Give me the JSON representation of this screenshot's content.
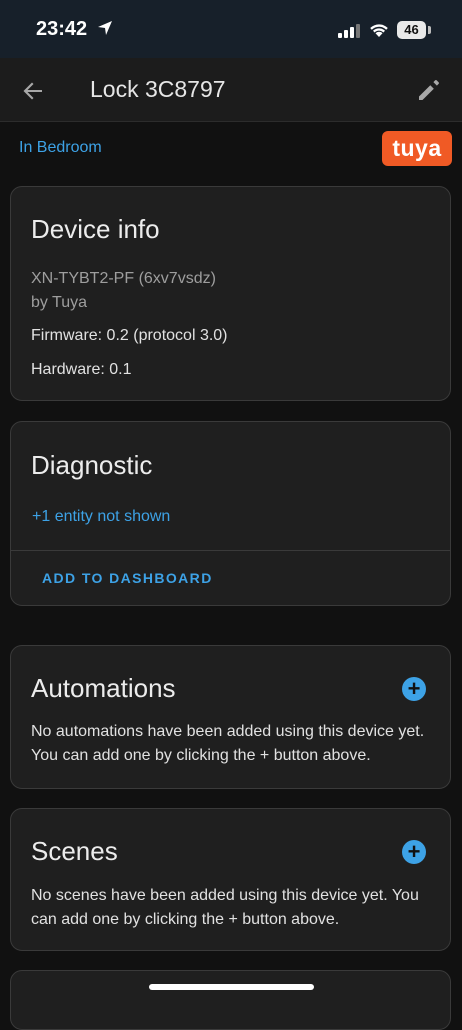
{
  "status_bar": {
    "time": "23:42",
    "battery": "46"
  },
  "header": {
    "title": "Lock 3C8797",
    "back_icon": "arrow-left-icon",
    "edit_icon": "pencil-icon"
  },
  "area": {
    "label": "In Bedroom"
  },
  "brand": {
    "logo_text": "tuya",
    "color": "#f05a25"
  },
  "device_info": {
    "title": "Device info",
    "model": "XN-TYBT2-PF (6xv7vsdz)",
    "manufacturer": "by Tuya",
    "firmware": "Firmware: 0.2 (protocol 3.0)",
    "hardware": "Hardware: 0.1"
  },
  "diagnostic": {
    "title": "Diagnostic",
    "hidden_entities": "+1 entity not shown",
    "add_to_dashboard": "ADD TO DASHBOARD"
  },
  "automations": {
    "title": "Automations",
    "description": "No automations have been added using this device yet. You can add one by clicking the + button above."
  },
  "scenes": {
    "title": "Scenes",
    "description": "No scenes have been added using this device yet. You can add one by clicking the + button above."
  },
  "colors": {
    "accent": "#3da2e6",
    "background": "#111111",
    "card": "#1f1f1f"
  }
}
